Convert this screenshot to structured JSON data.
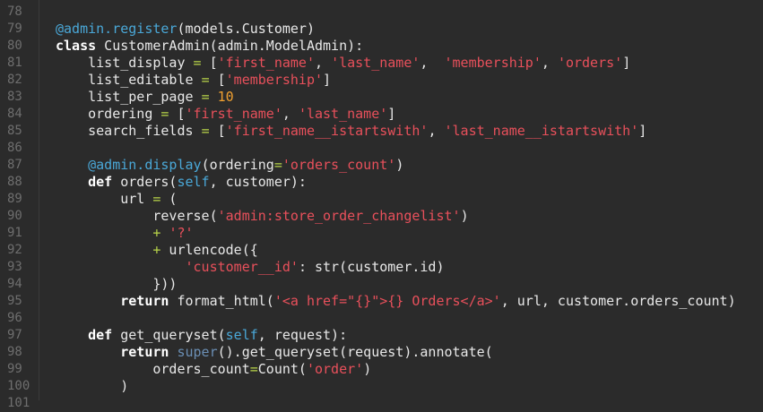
{
  "editor": {
    "language": "python",
    "colors": {
      "background": "#2b2b2b",
      "line_number": "#6e6e6e",
      "plain": "#e8e8e8",
      "keyword": "#ffffff",
      "string": "#e8505b",
      "number": "#f0a030",
      "operator": "#b9d54a",
      "decorator": "#4aa8d8",
      "self": "#4aa8d8",
      "builtin": "#6b8fb5"
    },
    "lines": [
      {
        "n": "78",
        "tokens": []
      },
      {
        "n": "79",
        "tokens": [
          [
            "dec",
            "@admin.register"
          ],
          [
            "plain",
            "(models.Customer)"
          ]
        ]
      },
      {
        "n": "80",
        "tokens": [
          [
            "kw",
            "class"
          ],
          [
            "plain",
            " CustomerAdmin(admin.ModelAdmin):"
          ]
        ]
      },
      {
        "n": "81",
        "tokens": [
          [
            "plain",
            "    list_display "
          ],
          [
            "op",
            "="
          ],
          [
            "plain",
            " ["
          ],
          [
            "str",
            "'first_name'"
          ],
          [
            "plain",
            ", "
          ],
          [
            "str",
            "'last_name'"
          ],
          [
            "plain",
            ",  "
          ],
          [
            "str",
            "'membership'"
          ],
          [
            "plain",
            ", "
          ],
          [
            "str",
            "'orders'"
          ],
          [
            "plain",
            "]"
          ]
        ]
      },
      {
        "n": "82",
        "tokens": [
          [
            "plain",
            "    list_editable "
          ],
          [
            "op",
            "="
          ],
          [
            "plain",
            " ["
          ],
          [
            "str",
            "'membership'"
          ],
          [
            "plain",
            "]"
          ]
        ]
      },
      {
        "n": "83",
        "tokens": [
          [
            "plain",
            "    list_per_page "
          ],
          [
            "op",
            "="
          ],
          [
            "plain",
            " "
          ],
          [
            "num",
            "10"
          ]
        ]
      },
      {
        "n": "84",
        "tokens": [
          [
            "plain",
            "    ordering "
          ],
          [
            "op",
            "="
          ],
          [
            "plain",
            " ["
          ],
          [
            "str",
            "'first_name'"
          ],
          [
            "plain",
            ", "
          ],
          [
            "str",
            "'last_name'"
          ],
          [
            "plain",
            "]"
          ]
        ]
      },
      {
        "n": "85",
        "tokens": [
          [
            "plain",
            "    search_fields "
          ],
          [
            "op",
            "="
          ],
          [
            "plain",
            " ["
          ],
          [
            "str",
            "'first_name__istartswith'"
          ],
          [
            "plain",
            ", "
          ],
          [
            "str",
            "'last_name__istartswith'"
          ],
          [
            "plain",
            "]"
          ]
        ]
      },
      {
        "n": "86",
        "tokens": []
      },
      {
        "n": "87",
        "tokens": [
          [
            "plain",
            "    "
          ],
          [
            "dec",
            "@admin.display"
          ],
          [
            "plain",
            "(ordering"
          ],
          [
            "op",
            "="
          ],
          [
            "str",
            "'orders_count'"
          ],
          [
            "plain",
            ")"
          ]
        ]
      },
      {
        "n": "88",
        "tokens": [
          [
            "plain",
            "    "
          ],
          [
            "kw",
            "def"
          ],
          [
            "plain",
            " orders("
          ],
          [
            "self",
            "self"
          ],
          [
            "plain",
            ", customer):"
          ]
        ]
      },
      {
        "n": "89",
        "tokens": [
          [
            "plain",
            "        url "
          ],
          [
            "op",
            "="
          ],
          [
            "plain",
            " ("
          ]
        ]
      },
      {
        "n": "90",
        "tokens": [
          [
            "plain",
            "            reverse("
          ],
          [
            "str",
            "'admin:store_order_changelist'"
          ],
          [
            "plain",
            ")"
          ]
        ]
      },
      {
        "n": "91",
        "tokens": [
          [
            "plain",
            "            "
          ],
          [
            "op",
            "+"
          ],
          [
            "plain",
            " "
          ],
          [
            "str",
            "'?'"
          ]
        ]
      },
      {
        "n": "92",
        "tokens": [
          [
            "plain",
            "            "
          ],
          [
            "op",
            "+"
          ],
          [
            "plain",
            " urlencode({"
          ]
        ]
      },
      {
        "n": "93",
        "tokens": [
          [
            "plain",
            "                "
          ],
          [
            "str",
            "'customer__id'"
          ],
          [
            "plain",
            ": str(customer.id)"
          ]
        ]
      },
      {
        "n": "94",
        "tokens": [
          [
            "plain",
            "            }))"
          ]
        ]
      },
      {
        "n": "95",
        "tokens": [
          [
            "plain",
            "        "
          ],
          [
            "kw",
            "return"
          ],
          [
            "plain",
            " format_html("
          ],
          [
            "str",
            "'<a href=\"{}\">{} Orders</a>'"
          ],
          [
            "plain",
            ", url, customer.orders_count)"
          ]
        ]
      },
      {
        "n": "96",
        "tokens": []
      },
      {
        "n": "97",
        "tokens": [
          [
            "plain",
            "    "
          ],
          [
            "kw",
            "def"
          ],
          [
            "plain",
            " get_queryset("
          ],
          [
            "self",
            "self"
          ],
          [
            "plain",
            ", request):"
          ]
        ]
      },
      {
        "n": "98",
        "tokens": [
          [
            "plain",
            "        "
          ],
          [
            "kw",
            "return"
          ],
          [
            "plain",
            " "
          ],
          [
            "builtin",
            "super"
          ],
          [
            "plain",
            "().get_queryset(request).annotate("
          ]
        ]
      },
      {
        "n": "99",
        "tokens": [
          [
            "plain",
            "            orders_count"
          ],
          [
            "op",
            "="
          ],
          [
            "plain",
            "Count("
          ],
          [
            "str",
            "'order'"
          ],
          [
            "plain",
            ")"
          ]
        ]
      },
      {
        "n": "100",
        "tokens": [
          [
            "plain",
            "        )"
          ]
        ]
      },
      {
        "n": "101",
        "tokens": []
      }
    ]
  }
}
